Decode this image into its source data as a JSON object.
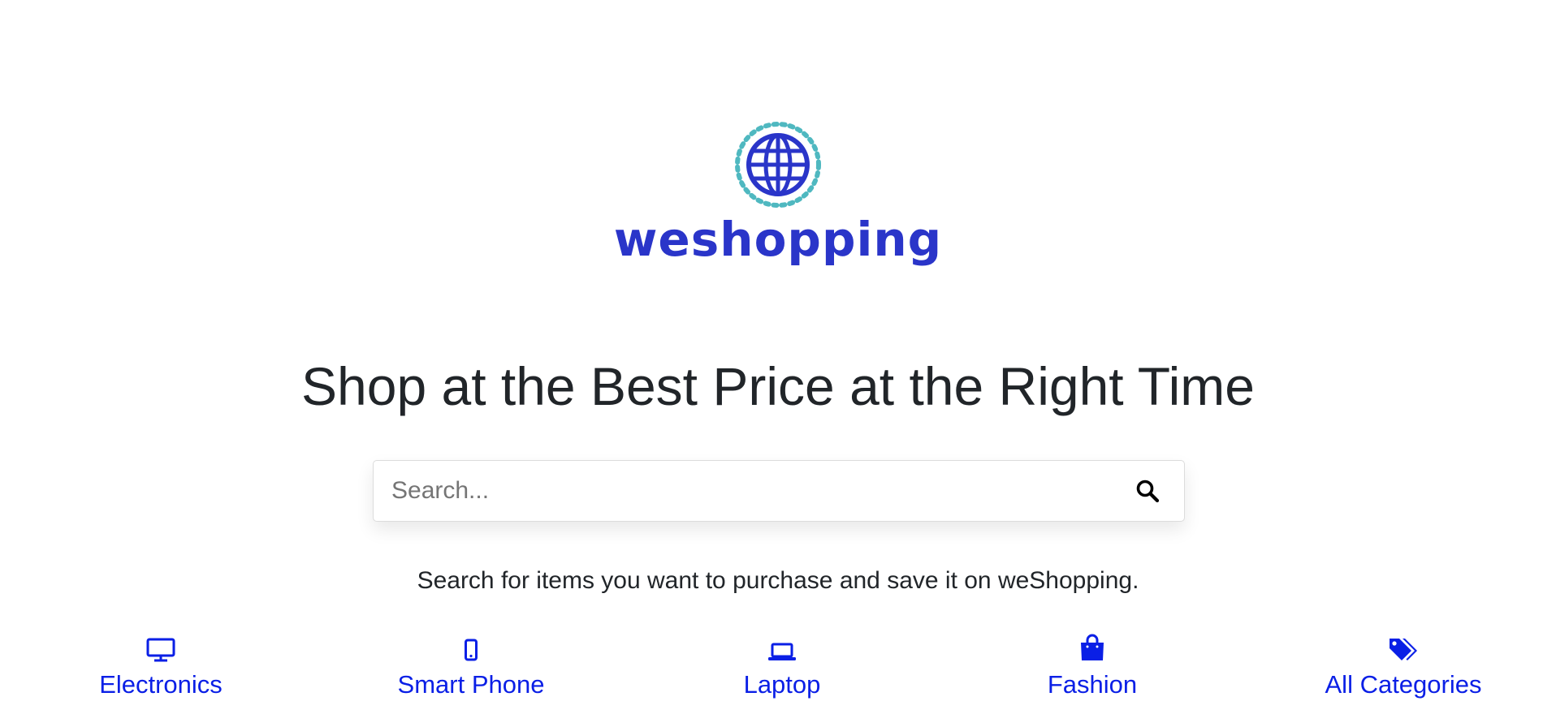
{
  "colors": {
    "brand_blue": "#2a35c9",
    "brand_teal": "#4fb8c0",
    "link_blue": "#0a1fe6",
    "text_dark": "#212529"
  },
  "logo": {
    "icon": "globe-icon",
    "text": "weshopping"
  },
  "headline": "Shop at the Best Price at the Right Time",
  "search": {
    "placeholder": "Search...",
    "value": "",
    "button_icon": "search-icon"
  },
  "tagline": "Search for items you want to purchase and save it on weShopping.",
  "categories": [
    {
      "label": "Electronics",
      "icon": "desktop-monitor-icon"
    },
    {
      "label": "Smart Phone",
      "icon": "mobile-phone-icon"
    },
    {
      "label": "Laptop",
      "icon": "laptop-icon"
    },
    {
      "label": "Fashion",
      "icon": "shopping-bag-icon"
    },
    {
      "label": "All Categories",
      "icon": "tags-icon"
    }
  ]
}
